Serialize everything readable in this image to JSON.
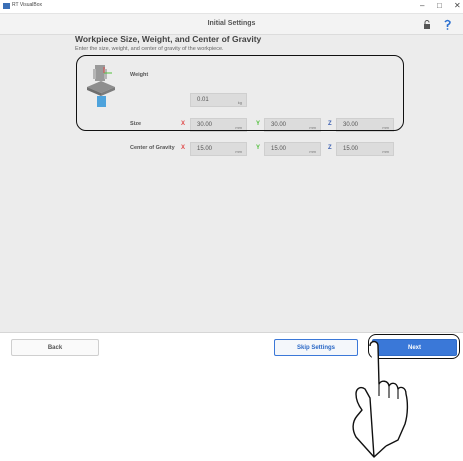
{
  "window": {
    "app_title": "RT VisualBox",
    "minimize": "–",
    "maximize": "□",
    "close": "✕"
  },
  "header": {
    "title": "Initial Settings",
    "lock_icon": "lock-icon",
    "help_icon": "help-icon"
  },
  "section": {
    "title": "Workpiece Size, Weight, and Center of Gravity",
    "description": "Enter the size, weight, and center of gravity of the workpiece."
  },
  "weight": {
    "label": "Weight",
    "value": "0.01",
    "unit": "kg"
  },
  "size": {
    "label": "Size",
    "x": {
      "axis": "X",
      "value": "30.00",
      "unit": "mm"
    },
    "y": {
      "axis": "Y",
      "value": "30.00",
      "unit": "mm"
    },
    "z": {
      "axis": "Z",
      "value": "30.00",
      "unit": "mm"
    }
  },
  "cog": {
    "label": "Center of Gravity",
    "x": {
      "axis": "X",
      "value": "15.00",
      "unit": "mm"
    },
    "y": {
      "axis": "Y",
      "value": "15.00",
      "unit": "mm"
    },
    "z": {
      "axis": "Z",
      "value": "15.00",
      "unit": "mm"
    }
  },
  "footer": {
    "back": "Back",
    "skip": "Skip Settings",
    "next": "Next"
  },
  "colors": {
    "accent": "#3a78d8",
    "axis_x": "#e04a4a",
    "axis_y": "#4fbf3a",
    "axis_z": "#3b5fb0",
    "background": "#ececec"
  }
}
